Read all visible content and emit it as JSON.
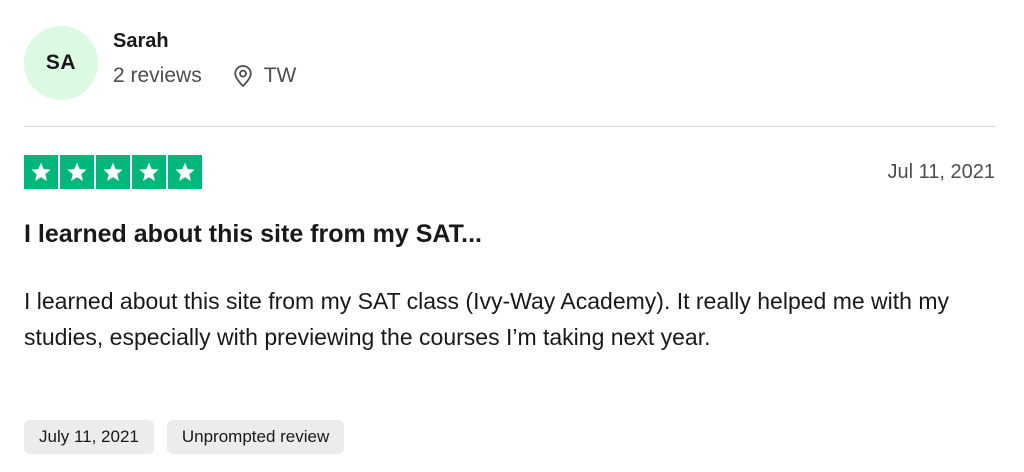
{
  "reviewer": {
    "initials": "SA",
    "name": "Sarah",
    "reviews_count": "2 reviews",
    "location": "TW",
    "avatar_color": "#dcf9e2"
  },
  "rating": {
    "stars": 5,
    "max": 5,
    "color": "#00b67a",
    "icon": "star-icon"
  },
  "review": {
    "date": "Jul 11, 2021",
    "title": "I learned about this site from my SAT...",
    "body": "I learned about this site from my SAT class (Ivy-Way Academy). It really helped me with my studies, especially with previewing the courses I’m taking next year."
  },
  "tags": {
    "experience_date": "July 11, 2021",
    "review_type": "Unprompted review"
  },
  "icons": {
    "location": "location-pin-icon"
  }
}
